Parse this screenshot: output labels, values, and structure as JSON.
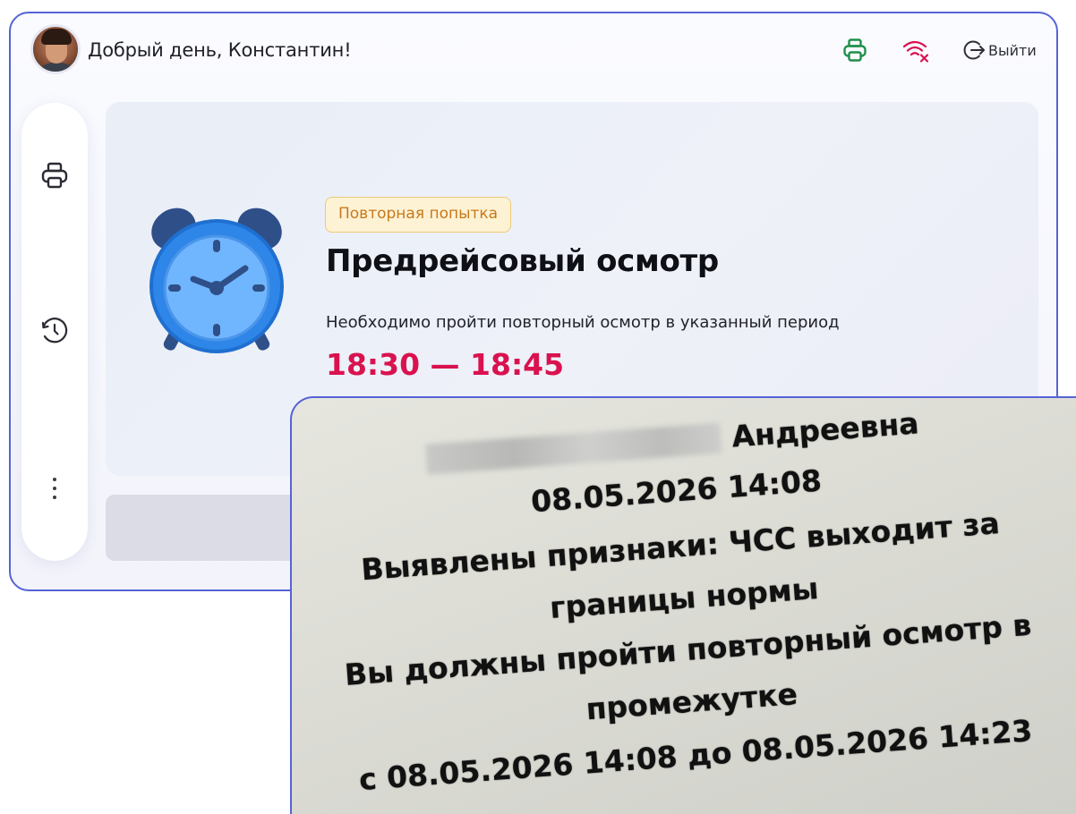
{
  "topbar": {
    "greeting": "Добрый день, Константин!",
    "logout_label": "Выйти",
    "icons": [
      "printer-icon",
      "wifi-off-icon",
      "logout-icon"
    ],
    "print_icon_color": "#1f8f4a",
    "wifi_icon_color": "#d9124f"
  },
  "sidebar": {
    "items": [
      "printer-icon",
      "history-icon",
      "more-icon"
    ]
  },
  "card": {
    "badge": "Повторная попытка",
    "title": "Предрейсовый осмотр",
    "subtitle": "Необходимо пройти повторный осмотр в указанный период",
    "time_range": "18:30 — 18:45",
    "time_color": "#d9124f",
    "badge_color": "#c7791a"
  },
  "receipt": {
    "name_visible": "Андреевна",
    "datetime": "08.05.2026 14:08",
    "finding_line1": "Выявлены признаки: ЧСС выходит за",
    "finding_line2": "границы нормы",
    "instruction_line1": "Вы должны пройти повторный осмотр в",
    "instruction_line2": "промежутке",
    "interval": "с 08.05.2026 14:08 до 08.05.2026 14:23"
  }
}
